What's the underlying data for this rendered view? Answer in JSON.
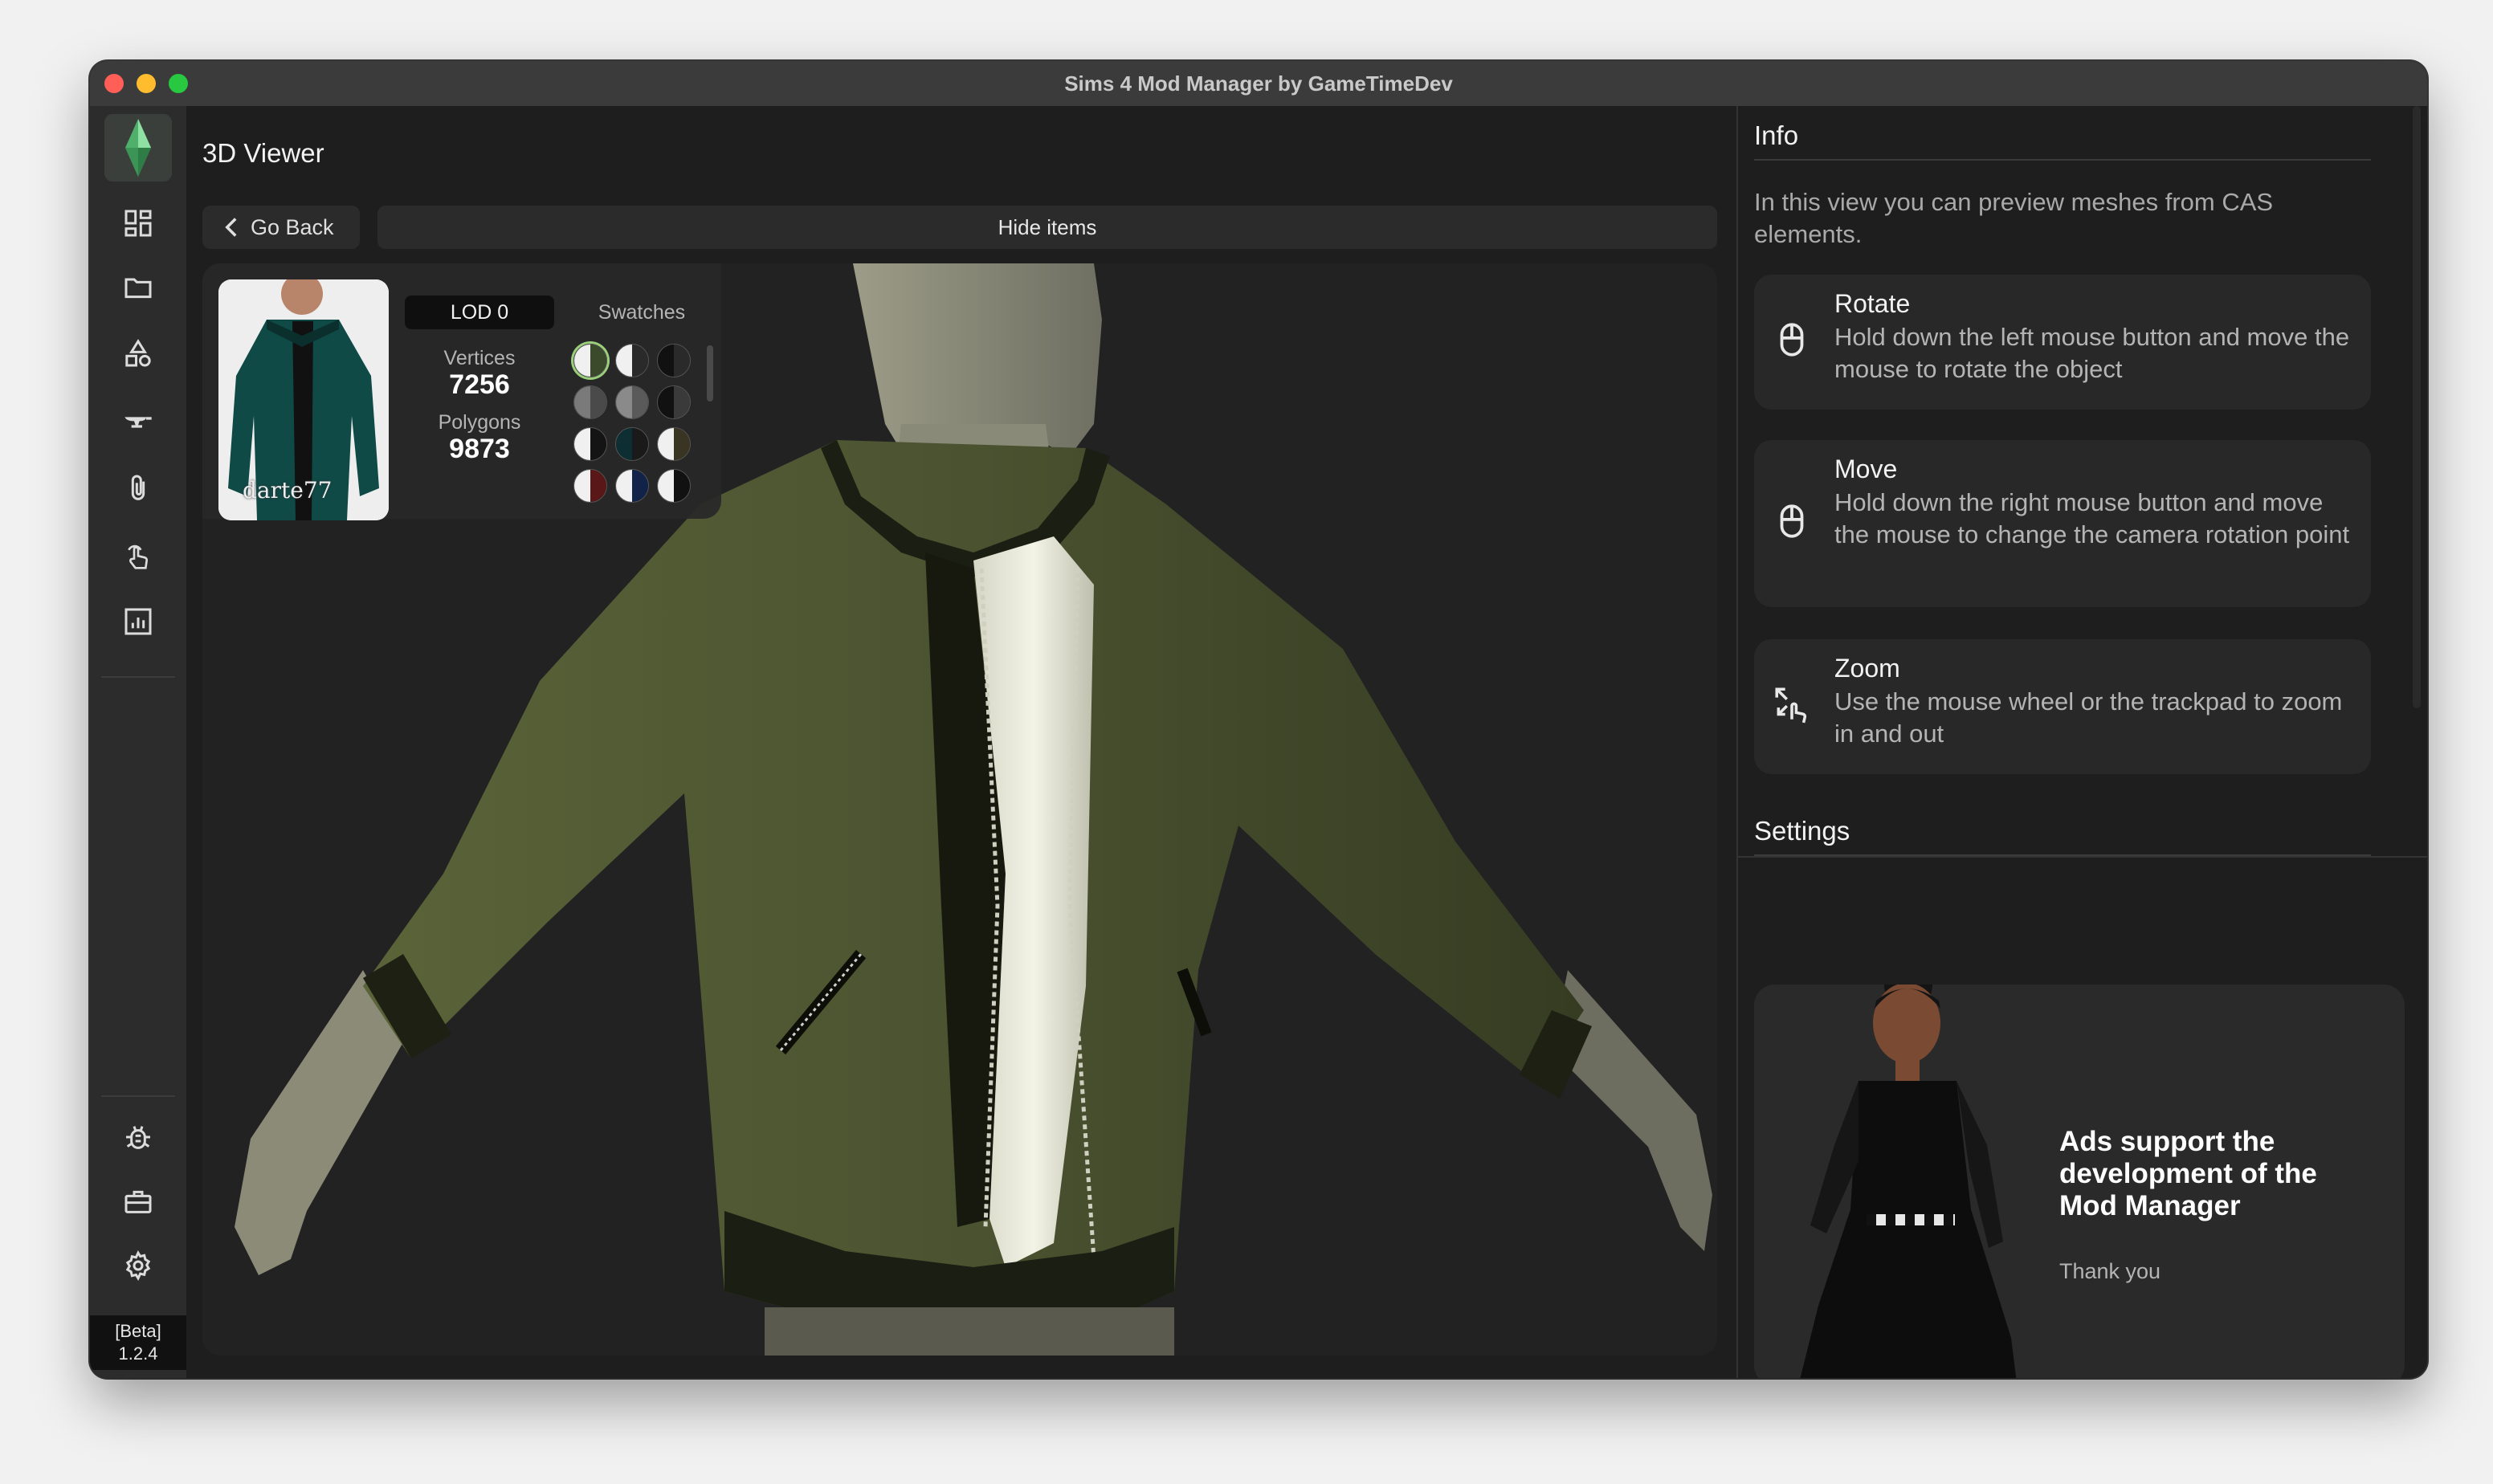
{
  "window": {
    "title": "Sims 4 Mod Manager by GameTimeDev"
  },
  "sidebar": {
    "logo": "plumbob-logo",
    "items": [
      {
        "icon": "dashboard-icon"
      },
      {
        "icon": "folder-icon"
      },
      {
        "icon": "shapes-icon"
      },
      {
        "icon": "anvil-icon"
      },
      {
        "icon": "paperclip-icon"
      },
      {
        "icon": "tap-gesture-icon"
      },
      {
        "icon": "report-icon"
      }
    ],
    "bottom_items": [
      {
        "icon": "bug-icon"
      },
      {
        "icon": "toolbox-icon"
      },
      {
        "icon": "gear-icon"
      },
      {
        "icon": "help-icon"
      }
    ],
    "version_tag": "[Beta]",
    "version": "1.2.4"
  },
  "main": {
    "title": "3D Viewer",
    "go_back_label": "Go Back",
    "hide_items_label": "Hide items",
    "thumbnail_watermark": "darte77",
    "lod_label": "LOD 0",
    "swatches_label": "Swatches",
    "vertices_label": "Vertices",
    "vertices_value": "7256",
    "polygons_label": "Polygons",
    "polygons_value": "9873",
    "swatches": [
      {
        "left": "#f0f0f0",
        "right": "#3b4a2a",
        "selected": true
      },
      {
        "left": "#f0f0f0",
        "right": "#2a2a2a"
      },
      {
        "left": "#111111",
        "right": "#2a2a2a"
      },
      {
        "left": "#7a7a7a",
        "right": "#4a4a4a"
      },
      {
        "left": "#8a8a8a",
        "right": "#5a5a5a"
      },
      {
        "left": "#111111",
        "right": "#3a3a3a"
      },
      {
        "left": "#f0f0f0",
        "right": "#141414"
      },
      {
        "left": "#0d2f33",
        "right": "#1a1a1a"
      },
      {
        "left": "#f0f0f0",
        "right": "#3a3422"
      },
      {
        "left": "#f0f0f0",
        "right": "#5a1717"
      },
      {
        "left": "#f0f0f0",
        "right": "#12234a"
      },
      {
        "left": "#f0f0f0",
        "right": "#111111"
      }
    ]
  },
  "info": {
    "title": "Info",
    "intro": "In this view you can preview meshes from CAS elements.",
    "cards": [
      {
        "icon": "mouse-icon",
        "title": "Rotate",
        "description": "Hold down the left mouse button and move the mouse to rotate the object"
      },
      {
        "icon": "mouse-icon",
        "title": "Move",
        "description": "Hold down the right mouse button and move the mouse to change the camera rotation point"
      },
      {
        "icon": "zoom-gesture-icon",
        "title": "Zoom",
        "description": "Use the mouse wheel or the trackpad to zoom in and out"
      }
    ],
    "settings_title": "Settings"
  },
  "ad": {
    "title": "Ads support the development of the Mod Manager",
    "thanks": "Thank you"
  }
}
